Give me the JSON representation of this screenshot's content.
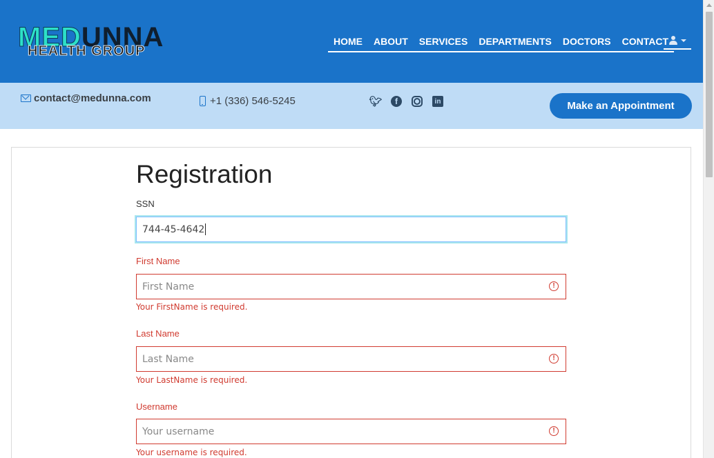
{
  "brand": {
    "logo_line1_a": "MED",
    "logo_line1_b": "UNNA",
    "logo_line2": "HEALTH GROUP"
  },
  "nav": {
    "items": [
      "HOME",
      "ABOUT",
      "SERVICES",
      "DEPARTMENTS",
      "DOCTORS",
      "CONTACT"
    ],
    "user_menu_icon": "user-icon"
  },
  "contact": {
    "email": "contact@medunna.com",
    "phone": "+1 (336) 546-5245",
    "social_icons": [
      "twitter-icon",
      "facebook-icon",
      "instagram-icon",
      "linkedin-icon"
    ],
    "appointment_label": "Make an Appointment"
  },
  "form": {
    "title": "Registration",
    "ssn": {
      "label": "SSN",
      "value": "744-45-4642"
    },
    "first_name": {
      "label": "First Name",
      "placeholder": "First Name",
      "error": "Your FirstName is required."
    },
    "last_name": {
      "label": "Last Name",
      "placeholder": "Last Name",
      "error": "Your LastName is required."
    },
    "username": {
      "label": "Username",
      "placeholder": "Your username",
      "error": "Your username is required."
    }
  },
  "colors": {
    "header": "#1a73c9",
    "infobar": "#bfdcf6",
    "error": "#d03a2f",
    "focus": "#a8e6ee"
  }
}
